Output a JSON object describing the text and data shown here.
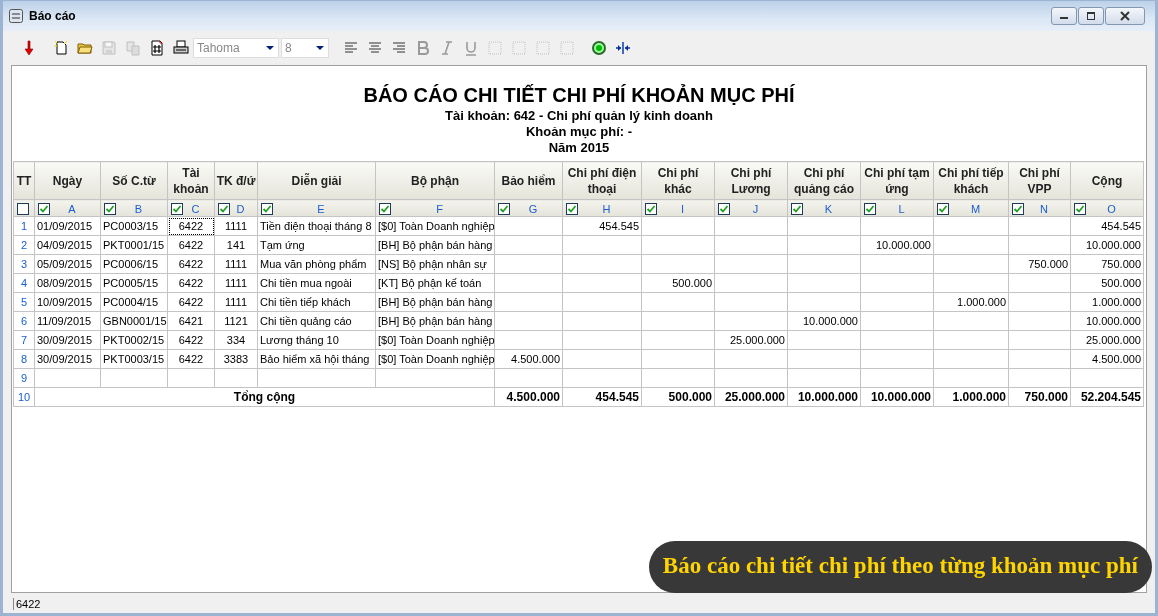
{
  "window": {
    "title": "Báo cáo"
  },
  "toolbar": {
    "buttons": [
      {
        "kind": "arrow",
        "disabled": false
      },
      {
        "kind": "new",
        "disabled": false
      },
      {
        "kind": "open",
        "disabled": false
      },
      {
        "kind": "save",
        "disabled": true
      },
      {
        "kind": "copy",
        "disabled": true
      },
      {
        "kind": "hash",
        "disabled": false
      },
      {
        "kind": "print",
        "disabled": false
      }
    ],
    "font": "Tahoma",
    "size": "8",
    "format_buttons": [
      {
        "kind": "align-left",
        "disabled": false
      },
      {
        "kind": "align-center",
        "disabled": false
      },
      {
        "kind": "align-right",
        "disabled": false
      },
      {
        "kind": "bold",
        "disabled": true
      },
      {
        "kind": "italic",
        "disabled": true
      },
      {
        "kind": "underline",
        "disabled": true
      },
      {
        "kind": "border",
        "disabled": true
      },
      {
        "kind": "border",
        "disabled": true
      },
      {
        "kind": "border",
        "disabled": true
      },
      {
        "kind": "border",
        "disabled": true
      },
      {
        "kind": "target",
        "disabled": false
      },
      {
        "kind": "fit",
        "disabled": false
      }
    ]
  },
  "report": {
    "title": "BÁO CÁO CHI TIẾT CHI PHÍ KHOẢN MỤC PHÍ",
    "subtitles": [
      "Tài khoản: 642 - Chi phí quản lý kinh doanh",
      "Khoản mục phí:  -",
      "Năm 2015"
    ]
  },
  "table": {
    "columns": [
      {
        "label": "TT",
        "kind": "index",
        "checked": false
      },
      {
        "label": "Ngày",
        "letter": "A",
        "kind": "text",
        "checked": true
      },
      {
        "label": "Số C.từ",
        "letter": "B",
        "kind": "text",
        "checked": true
      },
      {
        "label": "Tài khoản",
        "letter": "C",
        "kind": "code",
        "checked": true
      },
      {
        "label": "TK đ/ứ",
        "letter": "D",
        "kind": "code",
        "checked": true
      },
      {
        "label": "Diễn giải",
        "letter": "E",
        "kind": "text",
        "checked": true
      },
      {
        "label": "Bộ phận",
        "letter": "F",
        "kind": "text",
        "checked": true
      },
      {
        "label": "Bảo hiểm",
        "letter": "G",
        "kind": "amount",
        "checked": true
      },
      {
        "label": "Chi phí điện thoại",
        "letter": "H",
        "kind": "amount",
        "checked": true
      },
      {
        "label": "Chi phí khác",
        "letter": "I",
        "kind": "amount",
        "checked": true
      },
      {
        "label": "Chi phí Lương",
        "letter": "J",
        "kind": "amount",
        "checked": true
      },
      {
        "label": "Chi phí quảng cáo",
        "letter": "K",
        "kind": "amount",
        "checked": true
      },
      {
        "label": "Chi phí tạm ứng",
        "letter": "L",
        "kind": "amount",
        "checked": true
      },
      {
        "label": "Chi phí tiếp khách",
        "letter": "M",
        "kind": "amount",
        "checked": true
      },
      {
        "label": "Chi phí VPP",
        "letter": "N",
        "kind": "amount",
        "checked": true
      },
      {
        "label": "Cộng",
        "letter": "O",
        "kind": "amount",
        "checked": true
      }
    ],
    "rows": [
      {
        "focused": true,
        "cells": [
          "1",
          "01/09/2015",
          "PC0003/15",
          "6422",
          "1111",
          "Tiền điện thoại tháng 8",
          "[$0] Toàn Doanh nghiệp",
          "",
          "454.545",
          "",
          "",
          "",
          "",
          "",
          "",
          "454.545"
        ]
      },
      {
        "focused": false,
        "cells": [
          "2",
          "04/09/2015",
          "PKT0001/15",
          "6422",
          "141",
          "Tạm ứng",
          "[BH] Bộ phận bán hàng",
          "",
          "",
          "",
          "",
          "",
          "10.000.000",
          "",
          "",
          "10.000.000"
        ]
      },
      {
        "focused": false,
        "cells": [
          "3",
          "05/09/2015",
          "PC0006/15",
          "6422",
          "1111",
          "Mua văn phòng phẩm",
          "[NS] Bộ phận nhân sự",
          "",
          "",
          "",
          "",
          "",
          "",
          "",
          "750.000",
          "750.000"
        ]
      },
      {
        "focused": false,
        "cells": [
          "4",
          "08/09/2015",
          "PC0005/15",
          "6422",
          "1111",
          "Chi tiền mua ngoài",
          "[KT] Bộ phận kế toán",
          "",
          "",
          "500.000",
          "",
          "",
          "",
          "",
          "",
          "500.000"
        ]
      },
      {
        "focused": false,
        "cells": [
          "5",
          "10/09/2015",
          "PC0004/15",
          "6422",
          "1111",
          "Chi tiền tiếp khách",
          "[BH] Bộ phận bán hàng",
          "",
          "",
          "",
          "",
          "",
          "",
          "1.000.000",
          "",
          "1.000.000"
        ]
      },
      {
        "focused": false,
        "cells": [
          "6",
          "11/09/2015",
          "GBN0001/15",
          "6421",
          "1121",
          "Chi tiền quảng cáo",
          "[BH] Bộ phận bán hàng",
          "",
          "",
          "",
          "",
          "10.000.000",
          "",
          "",
          "",
          "10.000.000"
        ]
      },
      {
        "focused": false,
        "cells": [
          "7",
          "30/09/2015",
          "PKT0002/15",
          "6422",
          "334",
          "Lương tháng 10",
          "[$0] Toàn Doanh nghiệp",
          "",
          "",
          "",
          "25.000.000",
          "",
          "",
          "",
          "",
          "25.000.000"
        ]
      },
      {
        "focused": false,
        "cells": [
          "8",
          "30/09/2015",
          "PKT0003/15",
          "6422",
          "3383",
          "Bảo hiểm xã hội tháng",
          "[$0] Toàn Doanh nghiệp",
          "4.500.000",
          "",
          "",
          "",
          "",
          "",
          "",
          "",
          "4.500.000"
        ]
      },
      {
        "focused": false,
        "cells": [
          "9"
        ]
      }
    ],
    "total": {
      "cells": [
        "10",
        "Tổng cộng",
        "4.500.000",
        "454.545",
        "500.000",
        "25.000.000",
        "10.000.000",
        "10.000.000",
        "1.000.000",
        "750.000",
        "52.204.545"
      ]
    }
  },
  "caption": "Báo cáo chi tiết chi phí theo từng khoản mục phí",
  "status_bar": {
    "text": "6422"
  }
}
